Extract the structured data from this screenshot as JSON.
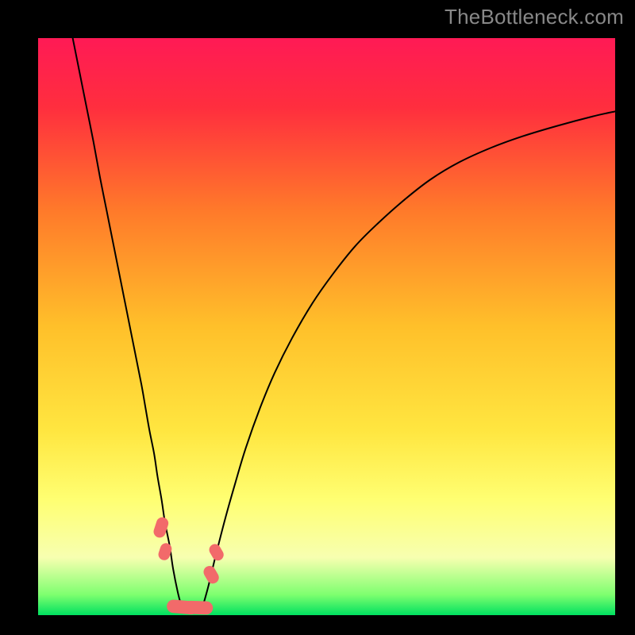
{
  "watermark": "TheBottleneck.com",
  "chart_data": {
    "type": "line",
    "title": "",
    "xlabel": "",
    "ylabel": "",
    "xlim": [
      0,
      100
    ],
    "ylim": [
      0,
      100
    ],
    "grid": false,
    "legend": false,
    "gradient_stops": [
      {
        "pos": 0.0,
        "color": "#ff1a55"
      },
      {
        "pos": 0.12,
        "color": "#ff2e3e"
      },
      {
        "pos": 0.3,
        "color": "#ff7a2a"
      },
      {
        "pos": 0.5,
        "color": "#ffc02a"
      },
      {
        "pos": 0.68,
        "color": "#ffe640"
      },
      {
        "pos": 0.8,
        "color": "#ffff72"
      },
      {
        "pos": 0.9,
        "color": "#f7ffb0"
      },
      {
        "pos": 0.965,
        "color": "#7dff6f"
      },
      {
        "pos": 1.0,
        "color": "#00e060"
      }
    ],
    "series": [
      {
        "name": "left-branch",
        "stroke": "#000000",
        "width": 2,
        "x": [
          6.0,
          7.2,
          8.4,
          9.6,
          10.7,
          11.9,
          13.1,
          14.3,
          15.5,
          16.7,
          17.9,
          18.6,
          19.3,
          20.1,
          20.7,
          21.4,
          22.0,
          22.8,
          23.4,
          24.2,
          24.9
        ],
        "y": [
          100,
          94.0,
          88.0,
          82.0,
          76.0,
          70.0,
          64.0,
          58.0,
          52.0,
          46.0,
          40.0,
          36.0,
          32.0,
          28.0,
          24.0,
          20.0,
          16.0,
          12.0,
          8.0,
          4.0,
          1.3
        ]
      },
      {
        "name": "right-branch",
        "stroke": "#000000",
        "width": 2,
        "x": [
          28.5,
          29.5,
          30.7,
          32.5,
          34.2,
          36.0,
          38.5,
          41.0,
          44.0,
          47.5,
          51.0,
          55.0,
          59.0,
          63.5,
          68.0,
          73.0,
          78.5,
          84.0,
          90.0,
          96.0,
          100.0
        ],
        "y": [
          1.4,
          5.0,
          10.0,
          17.0,
          23.0,
          29.0,
          36.0,
          42.0,
          48.0,
          54.0,
          59.0,
          64.0,
          68.0,
          72.0,
          75.5,
          78.5,
          81.0,
          83.0,
          84.8,
          86.4,
          87.3
        ]
      }
    ],
    "markers": [
      {
        "shape": "capsule",
        "color": "#f26a6a",
        "x": 21.3,
        "y": 15.2,
        "rot": -72,
        "len": 3.6,
        "w": 2.1
      },
      {
        "shape": "capsule",
        "color": "#f26a6a",
        "x": 22.0,
        "y": 11.0,
        "rot": -72,
        "len": 3.0,
        "w": 2.0
      },
      {
        "shape": "capsule",
        "color": "#f26a6a",
        "x": 25.0,
        "y": 1.4,
        "rot": 5,
        "len": 5.4,
        "w": 2.3
      },
      {
        "shape": "capsule",
        "color": "#f26a6a",
        "x": 27.8,
        "y": 1.3,
        "rot": 2,
        "len": 5.0,
        "w": 2.3
      },
      {
        "shape": "capsule",
        "color": "#f26a6a",
        "x": 30.0,
        "y": 7.0,
        "rot": 60,
        "len": 3.2,
        "w": 2.1
      },
      {
        "shape": "capsule",
        "color": "#f26a6a",
        "x": 30.9,
        "y": 10.9,
        "rot": 60,
        "len": 3.0,
        "w": 2.0
      }
    ]
  }
}
